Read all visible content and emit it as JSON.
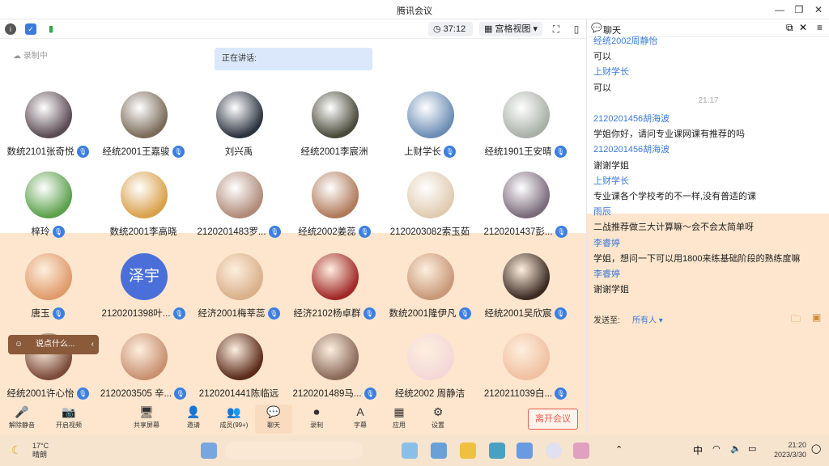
{
  "window": {
    "title": "腾讯会议"
  },
  "toolbar": {
    "timer": "37:12",
    "view_label": "宫格视图"
  },
  "meeting": {
    "recording_label": "录制中",
    "speaking_label": "正在讲话:",
    "chat_hint": "说点什么..."
  },
  "participants": [
    {
      "name": "数统2101张奇悦",
      "color": "#5a4a52",
      "mic": true
    },
    {
      "name": "经统2001王嘉骏",
      "color": "#7a6a58",
      "mic": true
    },
    {
      "name": "刘兴禹",
      "color": "#2b3340",
      "mic": false
    },
    {
      "name": "经统2001李宸洲",
      "color": "#4a4a3a",
      "mic": false
    },
    {
      "name": "上财学长",
      "color": "#6b8db5",
      "mic": true
    },
    {
      "name": "经统1901王安晴",
      "color": "#a8b0a6",
      "mic": true
    },
    {
      "name": "梓玲",
      "color": "#5ba04a",
      "mic": true
    },
    {
      "name": "数统2001李高晓",
      "color": "#d9a04a",
      "mic": false
    },
    {
      "name": "2120201483罗...",
      "color": "#b08a78",
      "mic": true
    },
    {
      "name": "经统2002姜蕊",
      "color": "#b07a5a",
      "mic": true
    },
    {
      "name": "2120203082索玉茹",
      "color": "#e0cbb0",
      "mic": false
    },
    {
      "name": "2120201437彭...",
      "color": "#7a6a7a",
      "mic": true
    },
    {
      "name": "唐玉",
      "color": "#e09a6a",
      "mic": true
    },
    {
      "name": "2120201398叶...",
      "color": "#4a6fd8",
      "mic": true,
      "initials": "泽宇"
    },
    {
      "name": "经济2001梅莘蕊",
      "color": "#d9b08a",
      "mic": true
    },
    {
      "name": "经济2102杨卓群",
      "color": "#a02828",
      "mic": true
    },
    {
      "name": "数统2001隆伊凡",
      "color": "#c89878",
      "mic": true
    },
    {
      "name": "经统2001吴欣宸",
      "color": "#3a2a22",
      "mic": true
    },
    {
      "name": "经统2001许心怡",
      "color": "#7a4a3a",
      "mic": true
    },
    {
      "name": "2120203505 辛...",
      "color": "#c89070",
      "mic": true
    },
    {
      "name": "2120201441陈临远",
      "color": "#5a2a1a",
      "mic": false
    },
    {
      "name": "2120201489马...",
      "color": "#8a6a5a",
      "mic": true
    },
    {
      "name": "经统2002 周静洁",
      "color": "#f4d8d8",
      "mic": false
    },
    {
      "name": "2120211039白...",
      "color": "#f0c0a0",
      "mic": true
    }
  ],
  "controls": [
    {
      "label": "解除静音",
      "icon": "🎤"
    },
    {
      "label": "开启视频",
      "icon": "📷"
    },
    {
      "label": "共享屏幕",
      "icon": "🖥"
    },
    {
      "label": "邀请",
      "icon": "👤"
    },
    {
      "label": "成员(99+)",
      "icon": "👥"
    },
    {
      "label": "聊天",
      "icon": "💬"
    },
    {
      "label": "录制",
      "icon": "⏺"
    },
    {
      "label": "字幕",
      "icon": "A"
    },
    {
      "label": "应用",
      "icon": "▦"
    },
    {
      "label": "设置",
      "icon": "⚙"
    }
  ],
  "leave_label": "离开会议",
  "chat": {
    "title": "聊天",
    "messages": [
      {
        "type": "sender",
        "text": "经统2002周静怡"
      },
      {
        "type": "text",
        "text": "可以"
      },
      {
        "type": "sender",
        "text": "上财学长"
      },
      {
        "type": "text",
        "text": "可以"
      },
      {
        "type": "time",
        "text": "21:17"
      },
      {
        "type": "sender",
        "text": "2120201456胡海波"
      },
      {
        "type": "text",
        "text": "学姐你好，请问专业课网课有推荐的吗"
      },
      {
        "type": "sender",
        "text": "2120201456胡海波"
      },
      {
        "type": "text",
        "text": "谢谢学姐"
      },
      {
        "type": "sender",
        "text": "上财学长"
      },
      {
        "type": "text",
        "text": "专业课各个学校考的不一样,没有普适的课"
      },
      {
        "type": "sender",
        "text": "雨辰"
      },
      {
        "type": "text",
        "text": "二战推荐做三大计算嘛～会不会太简单呀"
      },
      {
        "type": "sender",
        "text": "李睿婷"
      },
      {
        "type": "text",
        "text": "学姐，想问一下可以用1800来练基础阶段的熟练度嘛"
      },
      {
        "type": "sender",
        "text": "李睿婷"
      },
      {
        "type": "text",
        "text": "谢谢学姐"
      }
    ],
    "send_to_label": "发送至:",
    "recipient": "所有人"
  },
  "taskbar": {
    "weather": "17°C",
    "weather_desc": "晴朗",
    "time": "21:20",
    "date": "2023/3/30",
    "ime": "中"
  }
}
